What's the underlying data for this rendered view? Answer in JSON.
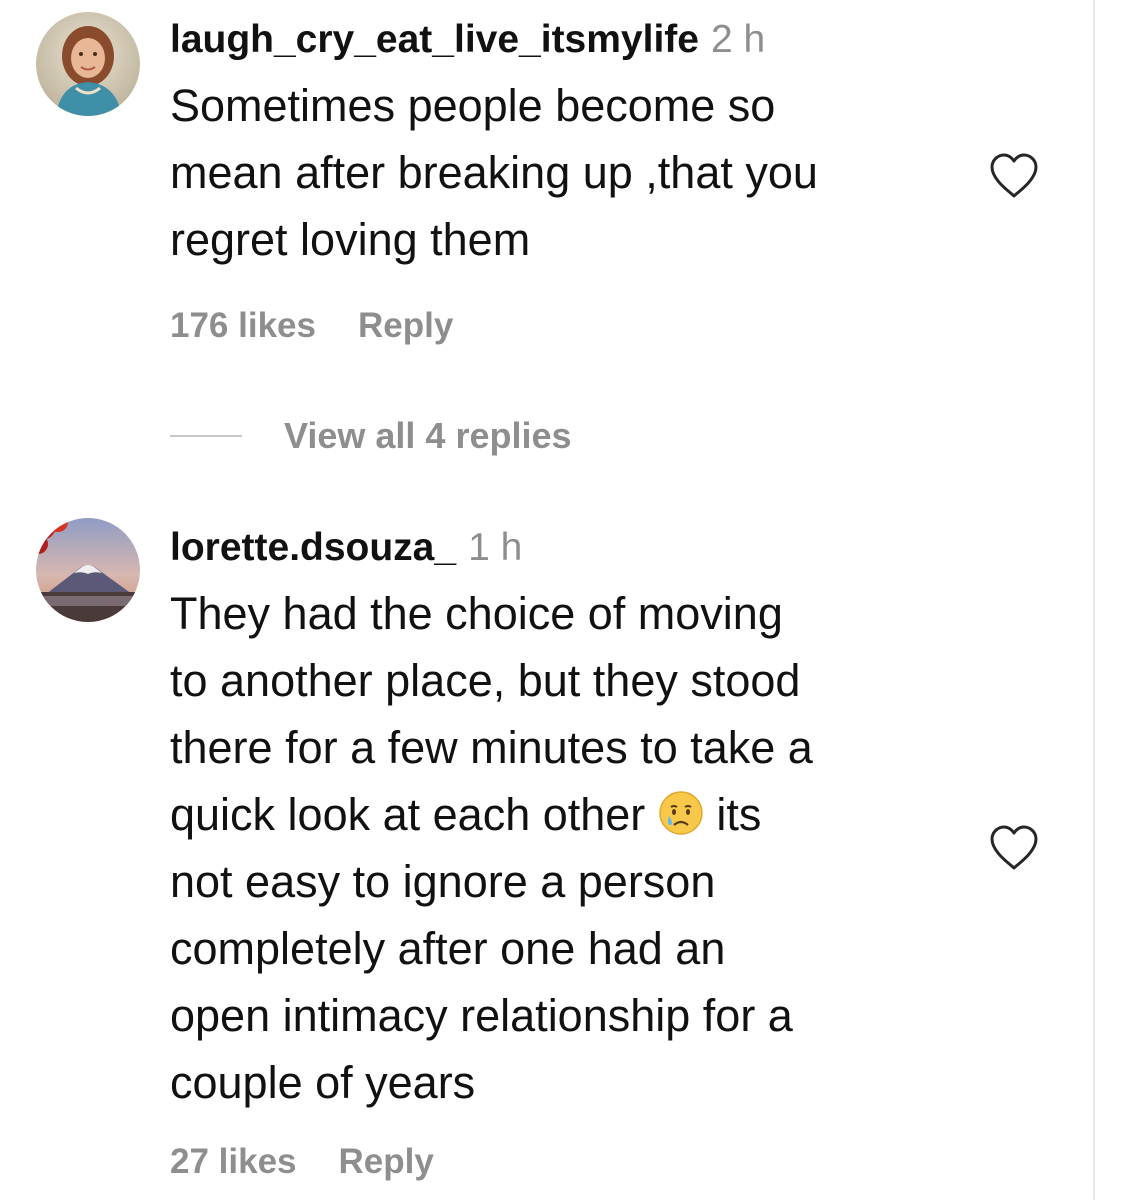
{
  "comments": [
    {
      "username": "laugh_cry_eat_live_itsmylife",
      "time": "2 h",
      "text_lines": [
        "Sometimes people become so",
        "mean after breaking up ,that you",
        "regret loving them"
      ],
      "likes": "176 likes",
      "reply_label": "Reply",
      "avatar_icon": "profile-photo-woman",
      "like_icon": "heart-outline-icon"
    },
    {
      "username": "lorette.dsouza_",
      "time": "1 h",
      "text_lines": [
        "They had the choice of moving",
        "to another place, but they stood",
        "there for a few minutes to take a",
        "quick look at each other",
        "its",
        "not easy to ignore a person",
        "completely after one had an",
        "open intimacy relationship for a",
        "couple of years"
      ],
      "emoji": "crying-face",
      "likes": "27 likes",
      "reply_label": "Reply",
      "avatar_icon": "profile-photo-mountain",
      "like_icon": "heart-outline-icon"
    }
  ],
  "view_replies": {
    "label": "View all 4 replies"
  },
  "colors": {
    "text": "#111111",
    "secondary": "#8e8e8e",
    "divider": "#c8c8c8"
  }
}
